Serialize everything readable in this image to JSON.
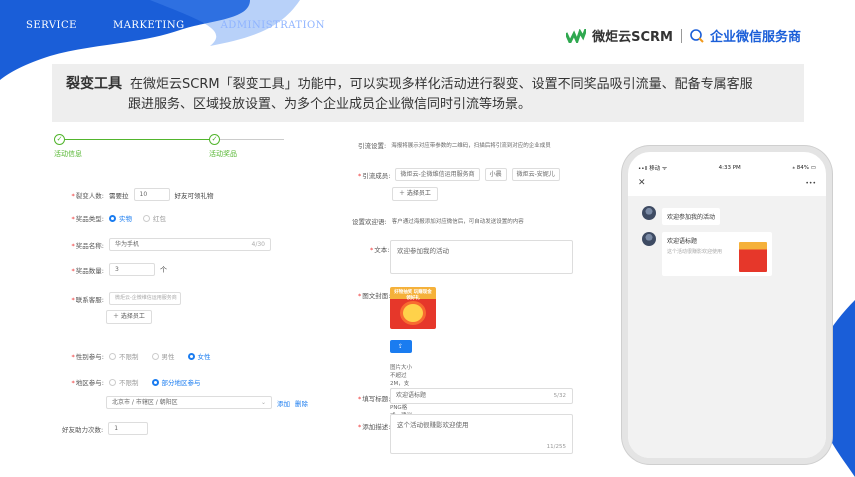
{
  "nav": [
    "SERVICE",
    "MARKETING",
    "ADMINISTRATION"
  ],
  "brand": {
    "name": "微炬云SCRM",
    "service": "企业微信服务商"
  },
  "banner": {
    "title": "裂变工具",
    "line1": "在微炬云SCRM「裂变工具」功能中，可以实现多样化活动进行裂变、设置不同奖品吸引流量、配备专属客服",
    "line2": "跟进服务、区域投放设置、为多个企业成员企业微信同时引流等场景。"
  },
  "steps": {
    "s1_num": "✓",
    "s1_label": "活动信息",
    "s2_num": "✓",
    "s2_label": "活动奖品"
  },
  "form": {
    "invite_label": "裂变人数:",
    "invite_pre": "需要拉",
    "invite_value": "10",
    "invite_post": "好友可领礼物",
    "prize_type_label": "奖品类型:",
    "prize_type_opt1": "实物",
    "prize_type_opt2": "红包",
    "prize_name_label": "奖品名称:",
    "prize_name_value": "华为手机",
    "prize_name_count": "4/30",
    "prize_qty_label": "奖品数量:",
    "prize_qty_value": "3",
    "prize_qty_unit": "个",
    "contact_label": "联系客服:",
    "contact_placeholder": "微炬云-企微维信运用服务商",
    "contact_btn": "＋ 选择员工",
    "gender_label": "性别参与:",
    "gender_opt1": "不限制",
    "gender_opt2": "男性",
    "gender_opt3": "女性",
    "region_label": "地区参与:",
    "region_opt1": "不限制",
    "region_opt2": "部分地区参与",
    "region_value": "北京市 / 市辖区 / 朝阳区",
    "region_add": "添加",
    "region_del": "删除",
    "assist_label": "好友助力次数:",
    "assist_value": "1"
  },
  "mid": {
    "qr_label": "引流设置:",
    "qr_desc": "海报将展示对应带参数的二维码，扫描后将引流到对应的企业成员",
    "member_label": "引流成员:",
    "member_tag1": "微炬云-企微维信运用服务商",
    "member_tag2": "小晨",
    "member_tag3": "微炬云-安妮儿",
    "member_btn": "＋ 选择员工",
    "welcome_set_label": "设置欢迎语:",
    "welcome_set_desc": "客户通过海报添加对应微信后，可自动发送设置的内容",
    "text_label": "文本:",
    "text_value": "欢迎参加我的活动",
    "cover_label": "图文封面:",
    "poster_text": "好物抽奖 玩赚现金领好礼",
    "upload_btn": "⇪ 重新上传",
    "upload_hint": "图片大小不超过2M，支持JPG、JPEG及PNG格式。建议尺寸200*200",
    "title_label": "填写标题:",
    "title_value": "欢迎语标题",
    "title_count": "5/32",
    "desc_label": "添加描述:",
    "desc_value": "这个活动很赚影欢迎使用",
    "desc_count": "11/255"
  },
  "phone": {
    "carrier": "••ll 移动  ᯤ",
    "time": "4:33 PM",
    "battery": "⁎ 84% ▭",
    "close": "✕",
    "more": "•••",
    "msg1": "欢迎参加我的活动",
    "card_title": "欢迎语标题",
    "card_sub": "这个活动很赚影欢迎使用"
  },
  "colors": {
    "primary": "#1a5ed8",
    "green": "#52b52d",
    "link": "#1a7cf0"
  }
}
